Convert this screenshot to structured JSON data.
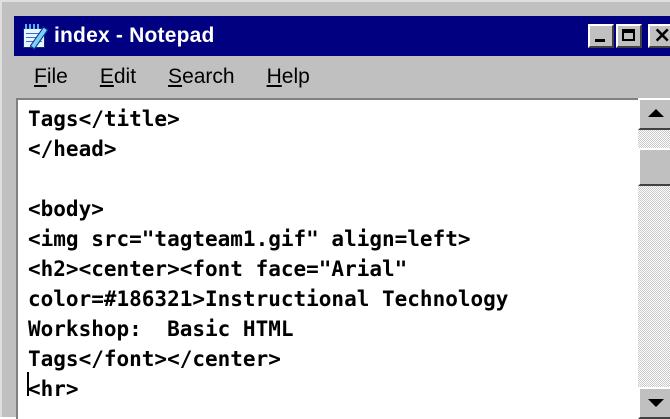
{
  "window": {
    "title": "index - Notepad"
  },
  "menu": {
    "file": {
      "mnemonic": "F",
      "rest": "ile"
    },
    "edit": {
      "mnemonic": "E",
      "rest": "dit"
    },
    "search": {
      "mnemonic": "S",
      "rest": "earch"
    },
    "help": {
      "mnemonic": "H",
      "rest": "elp"
    }
  },
  "editor": {
    "lines": [
      "Tags</title>",
      "</head>",
      "",
      "<body>",
      "<img src=\"tagteam1.gif\" align=left>",
      "<h2><center><font face=\"Arial\"",
      "color=#186321>Instructional Technology",
      "Workshop:  Basic HTML",
      "Tags</font></center>",
      "<hr>"
    ]
  },
  "icons": {
    "app": "notepad-icon",
    "minimize": "minimize-icon",
    "maximize": "maximize-icon",
    "close": "close-icon",
    "scroll_up": "arrow-up-icon",
    "scroll_down": "arrow-down-icon"
  },
  "colors": {
    "titlebar": "#000080",
    "chrome": "#c0c0c0",
    "editor_bg": "#ffffff"
  }
}
